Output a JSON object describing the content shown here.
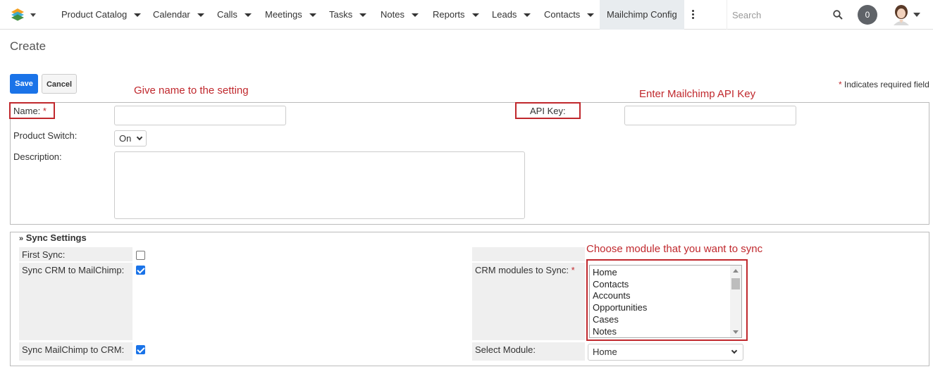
{
  "nav": {
    "items": [
      {
        "label": "Product Catalog"
      },
      {
        "label": "Calendar"
      },
      {
        "label": "Calls"
      },
      {
        "label": "Meetings"
      },
      {
        "label": "Tasks"
      },
      {
        "label": "Notes"
      },
      {
        "label": "Reports"
      },
      {
        "label": "Leads"
      },
      {
        "label": "Contacts"
      }
    ],
    "active_label": "Mailchimp Config",
    "search_placeholder": "Search",
    "notifications_count": "0"
  },
  "page": {
    "title": "Create",
    "save_label": "Save",
    "cancel_label": "Cancel",
    "required_note_star": "*",
    "required_note": "Indicates required field"
  },
  "annotations": {
    "name_hint": "Give name to the setting",
    "api_hint": "Enter Mailchimp API Key",
    "modules_hint": "Choose module that you want  to sync"
  },
  "form": {
    "name_label": "Name:",
    "required_star": "*",
    "name_value": "",
    "api_key_label": "API Key:",
    "api_key_value": "",
    "product_switch_label": "Product Switch:",
    "product_switch_value": "On",
    "description_label": "Description:",
    "description_value": ""
  },
  "sync": {
    "header": "Sync Settings",
    "first_sync_label": "First Sync:",
    "first_sync_checked": false,
    "crm_to_mc_label": "Sync CRM to MailChimp:",
    "crm_to_mc_checked": true,
    "mc_to_crm_label": "Sync MailChimp to CRM:",
    "mc_to_crm_checked": true,
    "crm_modules_label": "CRM modules to Sync:",
    "crm_modules_options": [
      "Home",
      "Contacts",
      "Accounts",
      "Opportunities",
      "Cases",
      "Notes"
    ],
    "select_module_label": "Select Module:",
    "select_module_value": "Home"
  },
  "colors": {
    "accent": "#1a73e8",
    "annotation_red": "#c0282d"
  }
}
